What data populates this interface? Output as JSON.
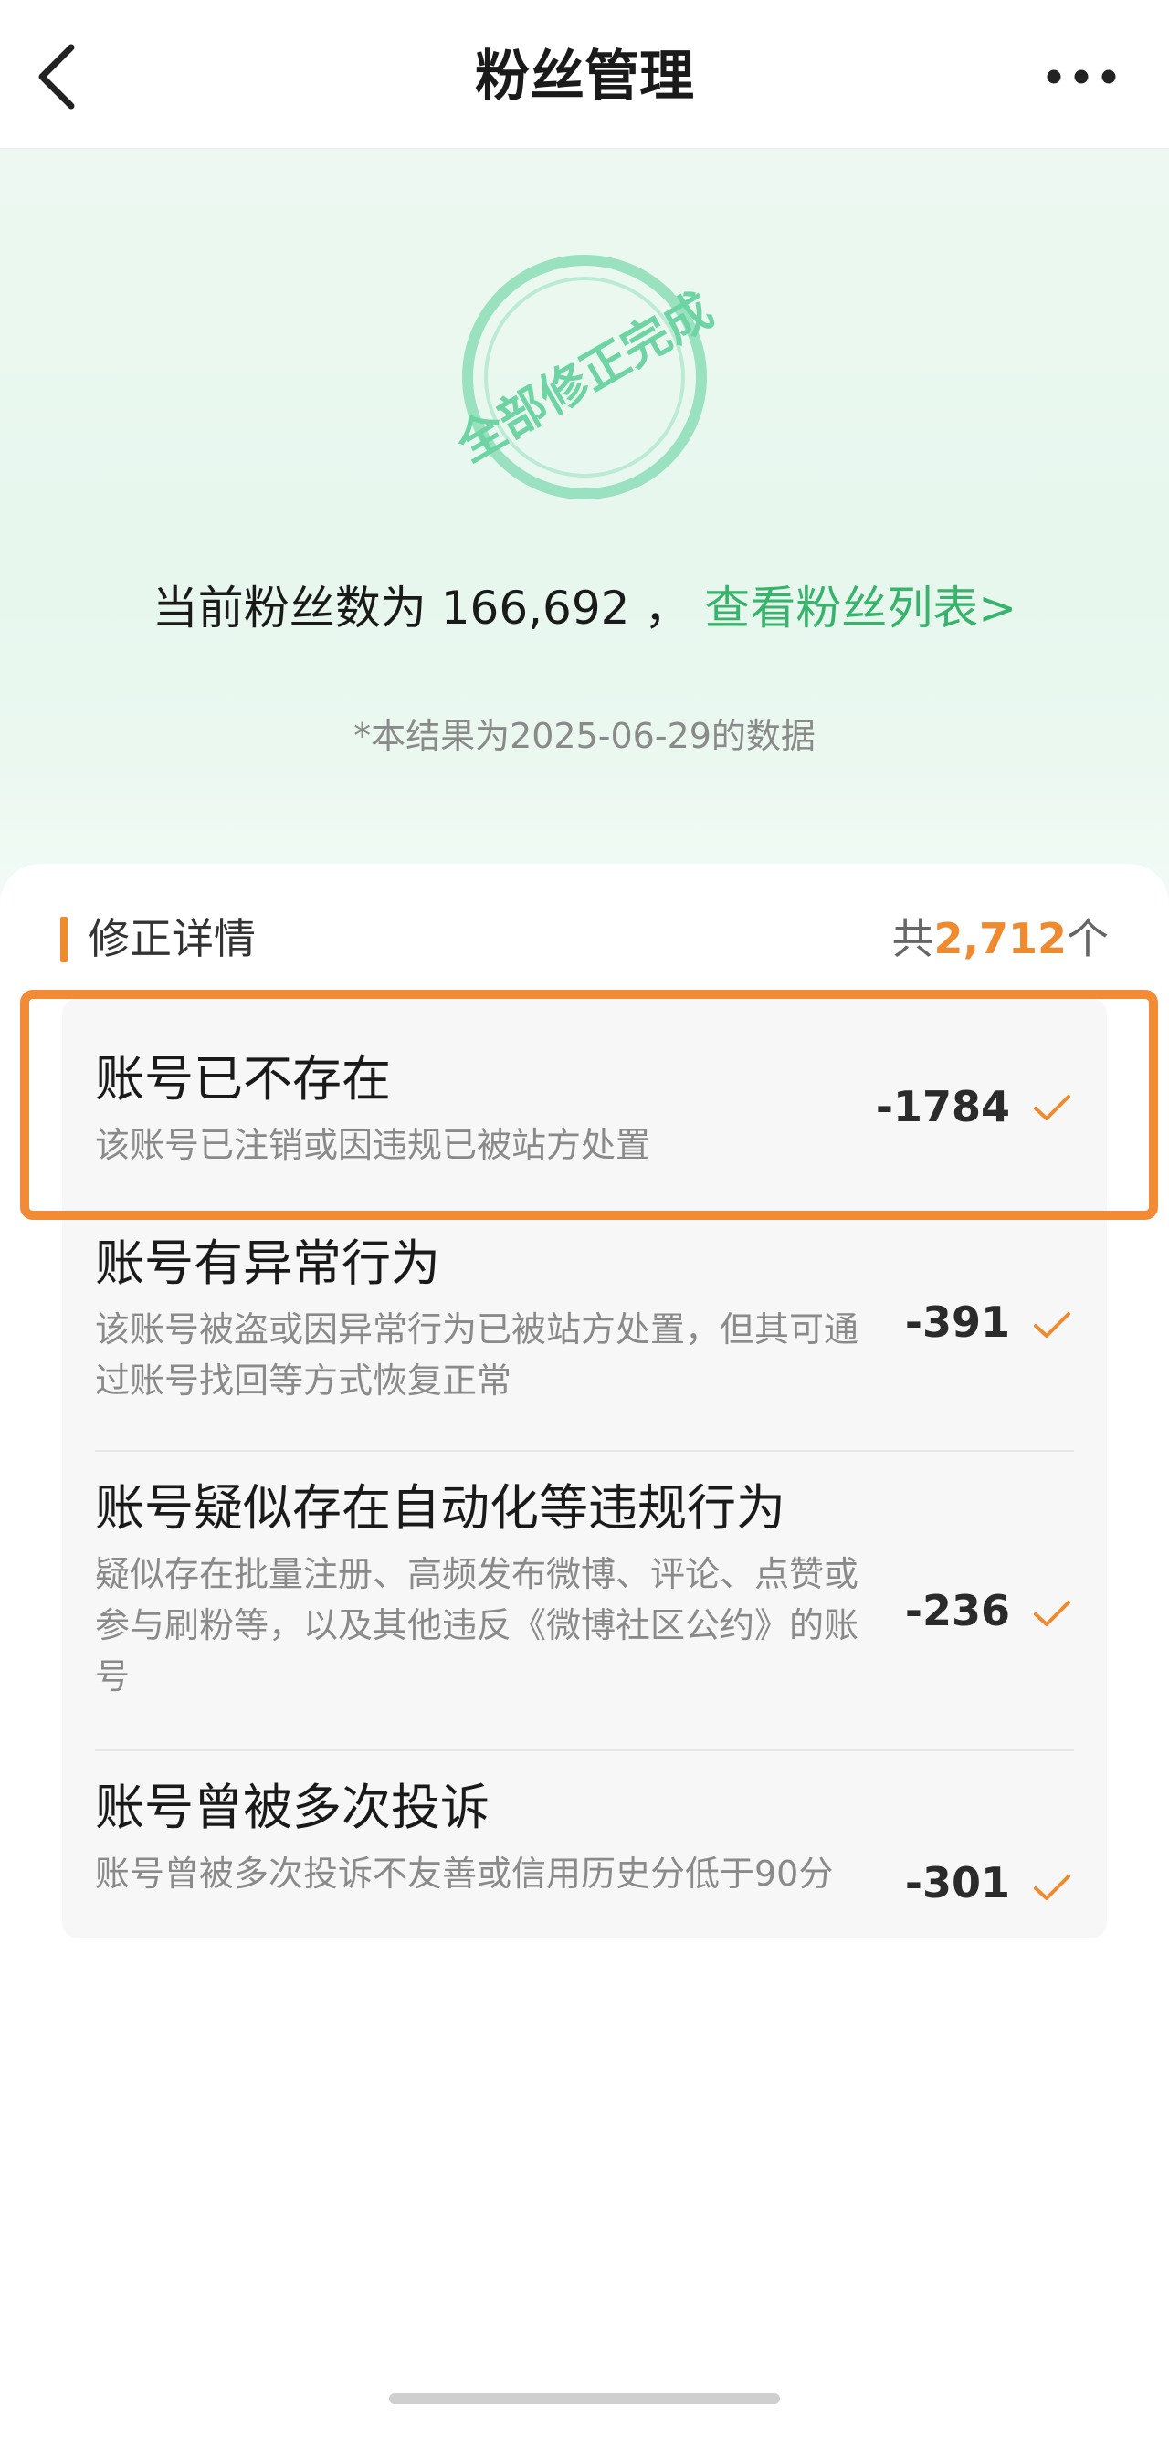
{
  "header": {
    "title": "粉丝管理",
    "back_icon": "chevron-left-icon",
    "more_icon": "more-dots-icon"
  },
  "hero": {
    "stamp_text": "全部修正完成",
    "fans_prefix": "当前粉丝数为",
    "fans_count": "166,692",
    "fans_separator": "，",
    "fans_link": "查看粉丝列表>",
    "data_note": "*本结果为2025-06-29的数据"
  },
  "details": {
    "section_title": "修正详情",
    "total_prefix": "共",
    "total_count": "2,712",
    "total_suffix": "个",
    "items": [
      {
        "title": "账号已不存在",
        "desc": "该账号已注销或因违规已被站方处置",
        "count": "-1784",
        "status_icon": "check-icon"
      },
      {
        "title": "账号有异常行为",
        "desc": "该账号被盗或因异常行为已被站方处置，但其可通过账号找回等方式恢复正常",
        "count": "-391",
        "status_icon": "check-icon"
      },
      {
        "title": "账号疑似存在自动化等违规行为",
        "desc": "疑似存在批量注册、高频发布微博、评论、点赞或参与刷粉等，以及其他违反《微博社区公约》的账号",
        "count": "-236",
        "status_icon": "check-icon"
      },
      {
        "title": "账号曾被多次投诉",
        "desc": "账号曾被多次投诉不友善或信用历史分低于90分",
        "count": "-301",
        "status_icon": "check-icon"
      }
    ]
  },
  "colors": {
    "accent_green": "#37b36b",
    "accent_orange": "#f08a2e",
    "highlight_border": "#f38a34",
    "stamp_green": "#6ed4a4"
  }
}
